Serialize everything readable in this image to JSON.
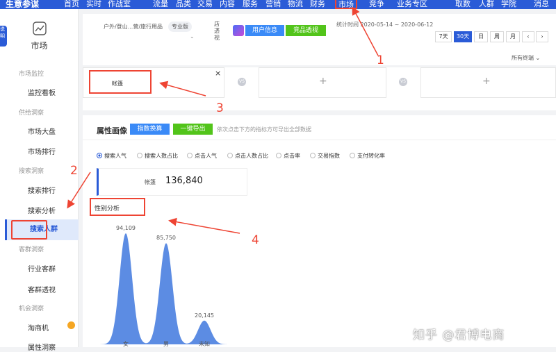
{
  "topnav": {
    "brand": "生意参谋",
    "items": [
      "首页",
      "实时",
      "作战室",
      "流量",
      "品类",
      "交易",
      "内容",
      "服务",
      "营销",
      "物流",
      "财务",
      "市场",
      "竞争",
      "业务专区",
      "取数",
      "人群",
      "学院",
      "消息"
    ],
    "active": "市场"
  },
  "sidebar": {
    "header": "市场",
    "left_tab": "说明",
    "sections": [
      {
        "title": "市场监控",
        "items": [
          "监控看板"
        ]
      },
      {
        "title": "供给洞察",
        "items": [
          "市场大盘",
          "市场排行"
        ]
      },
      {
        "title": "搜索洞察",
        "items": [
          "搜索排行",
          "搜索分析",
          "搜索人群"
        ]
      },
      {
        "title": "客群洞察",
        "items": [
          "行业客群",
          "客群透视"
        ]
      },
      {
        "title": "机会洞察",
        "items": [
          "淘商机",
          "属性洞察"
        ]
      }
    ],
    "active_item": "搜索人群"
  },
  "filter": {
    "category": "户外/登山...营/旅行用品",
    "tag": "专业版",
    "shop_label": "店透视",
    "btn_user": "用户信息",
    "btn_shop": "竞品透视",
    "stat_time": "统计时间 2020-05-14 ~ 2020-06-12",
    "ranges": [
      "7天",
      "30天",
      "日",
      "周",
      "月",
      "‹",
      "›"
    ],
    "active_range": "30天",
    "terminal": "所有终端"
  },
  "compare": {
    "first_keyword": "帐篷",
    "close": "×",
    "vs": "VS",
    "plus": "+"
  },
  "main": {
    "title": "属性画像",
    "btn_index": "指数换算",
    "btn_export": "一键导出",
    "hint": "依次点击下方的指标方可导出全部数据",
    "metrics": [
      "搜索人气",
      "搜索人数占比",
      "点击人气",
      "点击人数占比",
      "点击率",
      "交易指数",
      "支付转化率"
    ],
    "active_metric": "搜索人气",
    "keyword": "帐篷",
    "value": "136,840",
    "gender_title": "性别分析"
  },
  "chart_data": {
    "type": "area",
    "categories": [
      "女",
      "男",
      "未知"
    ],
    "values": [
      94109,
      85750,
      20145
    ],
    "labels": [
      "94,109",
      "85,750",
      "20,145"
    ],
    "color": "#4a7fe0"
  },
  "annotations": {
    "numbers": [
      "1",
      "2",
      "3",
      "4"
    ],
    "color": "#e43"
  },
  "watermark": "知乎 @君博电商"
}
